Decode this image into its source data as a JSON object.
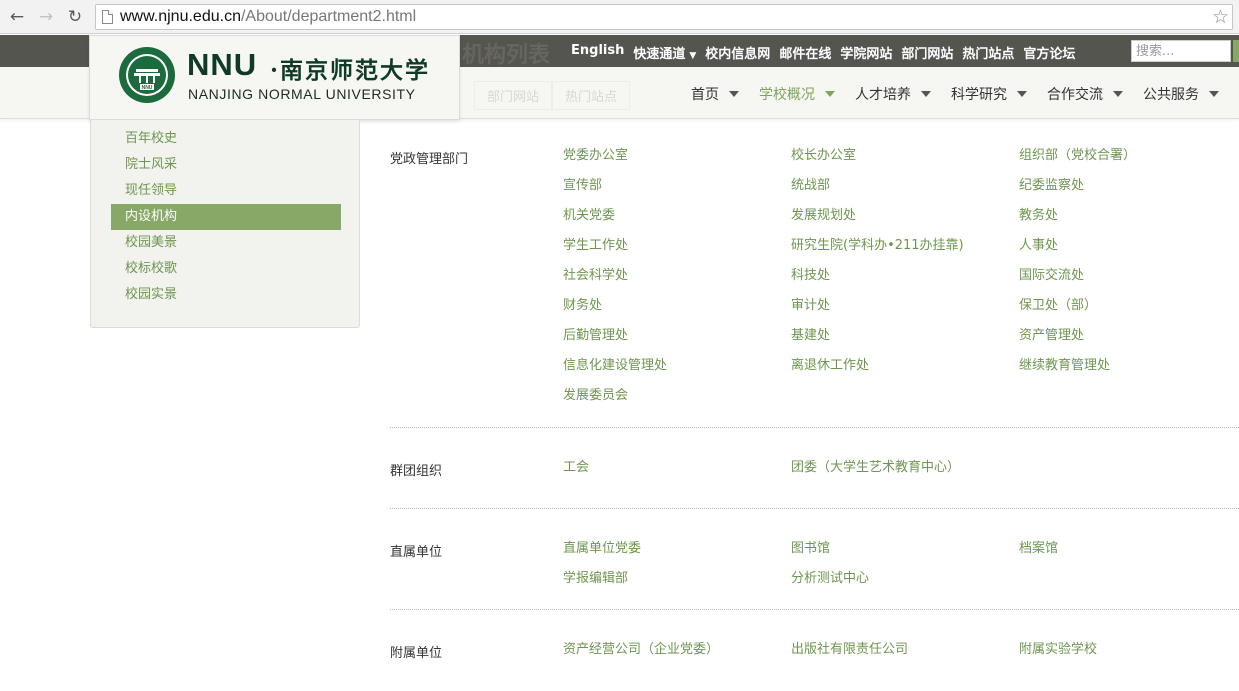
{
  "browser": {
    "url_host": "www.njnu.edu.cn",
    "url_path": "/About/department2.html"
  },
  "topbar": {
    "ghost_title": "机构列表",
    "links": [
      "English",
      "快速通道",
      "校内信息网",
      "邮件在线",
      "学院网站",
      "部门网站",
      "热门站点",
      "官方论坛"
    ],
    "search_placeholder": "搜索..."
  },
  "logo": {
    "abbr": "NNU",
    "cn": "·南京师范大学",
    "en": "NANJING NORMAL UNIVERSITY",
    "emblem_text": "NNU"
  },
  "nav": {
    "ghost_tabs": [
      "部门网站",
      "热门站点"
    ],
    "items": [
      {
        "label": "首页",
        "active": false
      },
      {
        "label": "学校概况",
        "active": true
      },
      {
        "label": "人才培养",
        "active": false
      },
      {
        "label": "科学研究",
        "active": false
      },
      {
        "label": "合作交流",
        "active": false
      },
      {
        "label": "公共服务",
        "active": false
      }
    ]
  },
  "sidebar": {
    "items": [
      {
        "label": "百年校史",
        "active": false
      },
      {
        "label": "院士风采",
        "active": false
      },
      {
        "label": "现任领导",
        "active": false
      },
      {
        "label": "内设机构",
        "active": true
      },
      {
        "label": "校园美景",
        "active": false
      },
      {
        "label": "校标校歌",
        "active": false
      },
      {
        "label": "校园实景",
        "active": false
      }
    ]
  },
  "departments": [
    {
      "title": "党政管理部门",
      "items": [
        "党委办公室",
        "校长办公室",
        "组织部（党校合署）",
        "宣传部",
        "统战部",
        "纪委监察处",
        "机关党委",
        "发展规划处",
        "教务处",
        "学生工作处",
        "研究生院(学科办•211办挂靠)",
        "人事处",
        "社会科学处",
        "科技处",
        "国际交流处",
        "财务处",
        "审计处",
        "保卫处（部）",
        "后勤管理处",
        "基建处",
        "资产管理处",
        "信息化建设管理处",
        "离退休工作处",
        "继续教育管理处",
        "发展委员会"
      ]
    },
    {
      "title": "群团组织",
      "items": [
        "工会",
        "团委（大学生艺术教育中心）"
      ]
    },
    {
      "title": "直属单位",
      "items": [
        "直属单位党委",
        "图书馆",
        "档案馆",
        "学报编辑部",
        "分析测试中心"
      ]
    },
    {
      "title": "附属单位",
      "items": [
        "资产经营公司（企业党委）",
        "出版社有限责任公司",
        "附属实验学校"
      ]
    }
  ],
  "colors": {
    "accent_green": "#7fa45a",
    "sidebar_active": "#87a866",
    "topbar": "#55554f",
    "logo_green": "#0f3a24"
  }
}
